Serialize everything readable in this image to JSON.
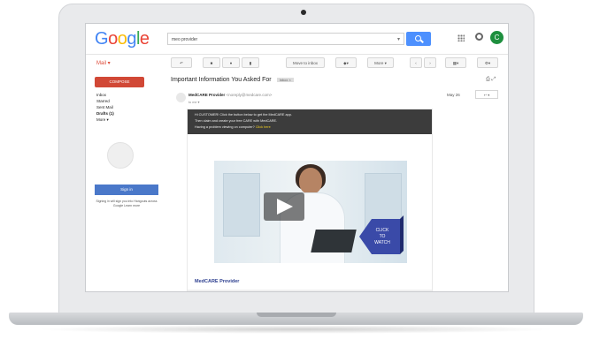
{
  "gmail": {
    "logo": {
      "letters": [
        {
          "ch": "G",
          "color": "#4285F4"
        },
        {
          "ch": "o",
          "color": "#EA4335"
        },
        {
          "ch": "o",
          "color": "#FBBC05"
        },
        {
          "ch": "g",
          "color": "#4285F4"
        },
        {
          "ch": "l",
          "color": "#34A853"
        },
        {
          "ch": "e",
          "color": "#EA4335"
        }
      ]
    },
    "search": {
      "value": "meo provider"
    },
    "avatar_letter": "C",
    "mail_label": "Mail ▾",
    "toolbar": {
      "archive": "↶",
      "spam": "■",
      "delete": "●",
      "move": "▮",
      "more_label": "Move to inbox",
      "labels": "◆▾",
      "more": "More ▾",
      "prev": "‹",
      "next": "›",
      "settings": "⚙▾",
      "view": "▦▾"
    },
    "sidebar": {
      "compose": "COMPOSE",
      "items": [
        "Inbox",
        "Starred",
        "Sent Mail",
        "Drafts (1)",
        "More ▾"
      ],
      "signin_button": "Sign in",
      "signin_note": "Signing in will sign you into Hangouts across Google Learn more"
    },
    "message": {
      "subject": "Important Information You Asked For",
      "subject_tag": "Inbox ×",
      "sender_name": "MedCARE Provider",
      "sender_email": "<noreply@medcare.com>",
      "to": "to me ▾",
      "date": "May 26",
      "reply": "↩ ▾",
      "banner_lines": [
        "Hi CUSTOMER! Click the button below to get the MedCARE app.",
        "Then claim and create your free CARE with MedCARE.",
        "Having a problem viewing on computer? Click here"
      ],
      "banner_link": "Click here",
      "cta_text": "CLICK TO WATCH",
      "brand_footer": "MedCARE Provider"
    }
  }
}
